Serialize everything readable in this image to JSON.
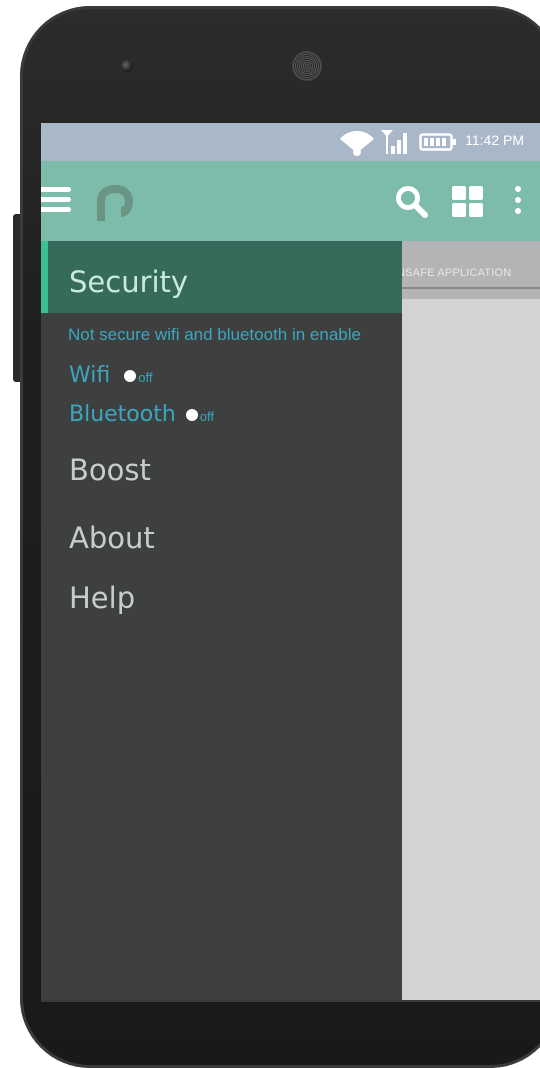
{
  "status_bar": {
    "time": "11:42 PM",
    "icons": [
      "wifi-icon",
      "signal-icon",
      "battery-icon"
    ]
  },
  "app_bar": {
    "icons": [
      "menu-icon",
      "app-logo-icon",
      "search-icon",
      "grid-icon",
      "more-icon"
    ]
  },
  "tabs": {
    "partial_label": "NSAFE APPLICATION"
  },
  "drawer": {
    "active": {
      "label": "Security",
      "note": "Not secure wifi and bluetooth in enable",
      "toggles": [
        {
          "label": "Wifi",
          "state": "off"
        },
        {
          "label": "Bluetooth",
          "state": "off"
        }
      ]
    },
    "items": [
      {
        "label": "Boost"
      },
      {
        "label": "About"
      },
      {
        "label": "Help"
      }
    ]
  },
  "colors": {
    "status_bar": "#a8b8c8",
    "app_bar": "#7dbcaa",
    "drawer_bg": "#3e3f3f",
    "drawer_active_bg": "#366a5a",
    "accent": "#3dbf93",
    "toggle_text": "#3aa7bf"
  }
}
